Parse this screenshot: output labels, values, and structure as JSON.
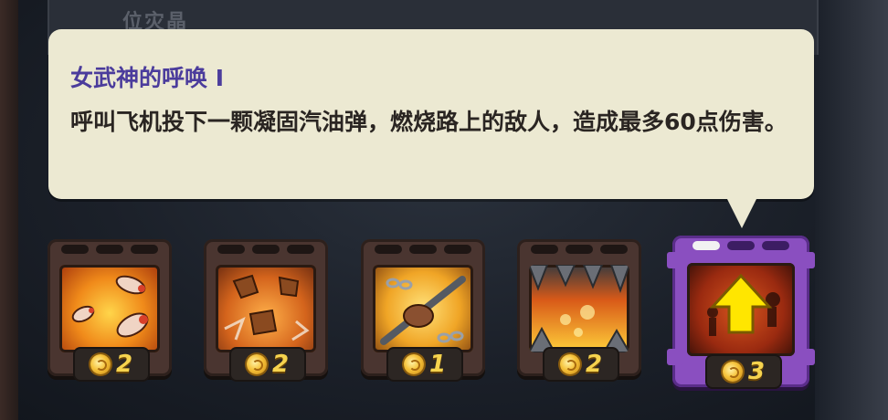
{
  "background": {
    "panel_title": "位灾晶"
  },
  "tooltip": {
    "title": "女武神的呼唤 I",
    "description": "呼叫飞机投下一颗凝固汽油弹，燃烧路上的敌人，造成最多60点伤害。"
  },
  "upgrades": [
    {
      "icon": "missiles-icon",
      "cost": "2",
      "selected": false
    },
    {
      "icon": "rock-explosion-icon",
      "cost": "2",
      "selected": false
    },
    {
      "icon": "fist-chain-icon",
      "cost": "1",
      "selected": false
    },
    {
      "icon": "fire-spikes-icon",
      "cost": "2",
      "selected": false
    },
    {
      "icon": "upgrade-arrow-icon",
      "cost": "3",
      "selected": true
    }
  ],
  "colors": {
    "title": "#4b3c9c",
    "tooltip_bg": "#ece9d2",
    "selected_frame": "#8a4fc0",
    "coin": "#f6c23a"
  }
}
